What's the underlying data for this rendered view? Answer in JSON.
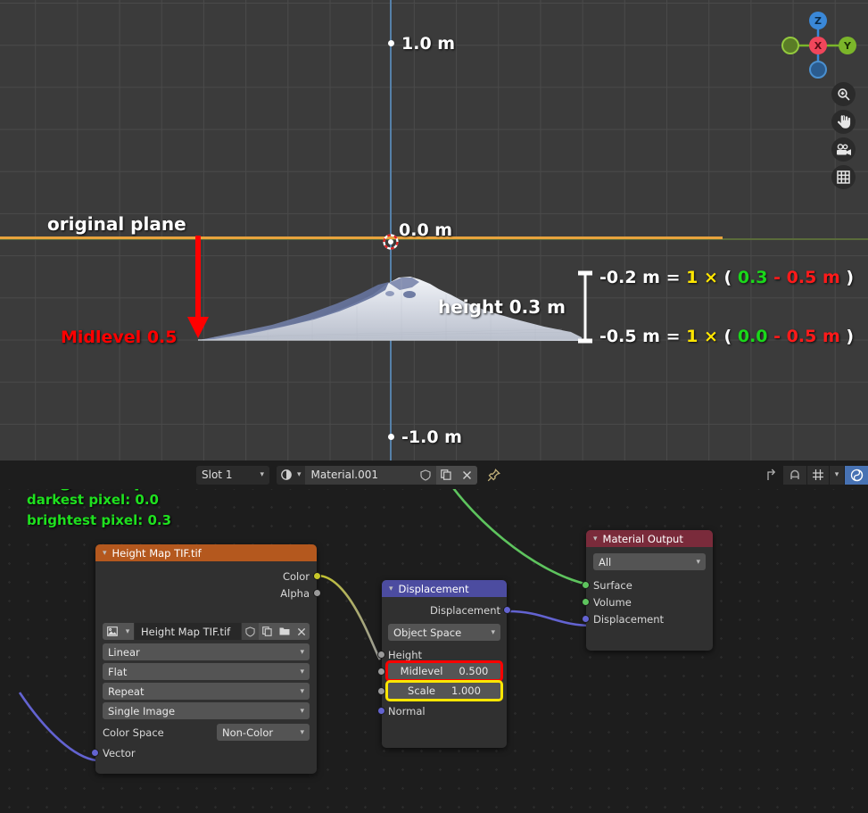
{
  "viewport": {
    "labels": {
      "top_measure": "1.0 m",
      "origin_measure": "0.0 m",
      "bottom_measure": "-1.0 m",
      "original_plane": "original plane",
      "midlevel_arrow": "Midlevel 0.5",
      "height_bracket": "height 0.3 m"
    },
    "equations": [
      {
        "result": "-0.2 m",
        "eq": "=",
        "scale": "1",
        "times": "×",
        "open": "(",
        "pixel": "0.3",
        "minus": "-",
        "midlevel": "0.5 m",
        "close": ")"
      },
      {
        "result": "-0.5 m",
        "eq": "=",
        "scale": "1",
        "times": "×",
        "open": "(",
        "pixel": "0.0",
        "minus": "-",
        "midlevel": "0.5 m",
        "close": ")"
      }
    ],
    "gizmo": {
      "z": "Z",
      "x": "X",
      "y": "Y"
    },
    "colors": {
      "background": "#3b3b3b",
      "grid": "#4a4a4a",
      "axis_z": "#5680a8",
      "axis_x": "#5a6b3a",
      "object_outline": "#e8a33d",
      "annotation_red": "#ff0000",
      "annotation_yellow": "#ffe600",
      "annotation_green": "#1ad81a",
      "annotation_white": "#ffffff"
    }
  },
  "node_editor": {
    "header": {
      "slot_label": "Slot 1",
      "material_name": "Material.001",
      "icons": [
        "material-sphere-icon",
        "shield-icon",
        "copy-icon",
        "close-icon",
        "pin-icon"
      ],
      "right_icons": [
        "snap-parent-icon",
        "magnet-icon",
        "snap-settings-icon",
        "overlay-toggle-icon"
      ]
    },
    "annotation": {
      "title": "height map",
      "line1": "darkest pixel: 0.0",
      "line2": "brightest pixel: 0.3",
      "color": "#1fe01f"
    },
    "nodes": {
      "image_texture": {
        "title": "Height Map TIF.tif",
        "header_color": "#b4581e",
        "outputs": [
          {
            "name": "Color",
            "color": "#c7c729"
          },
          {
            "name": "Alpha",
            "color": "#9a9a9a"
          }
        ],
        "image_name": "Height Map TIF.tif",
        "image_buttons": [
          "image-icon",
          "browse-chevron",
          "shield-icon",
          "copy-icon",
          "open-folder-icon",
          "close-icon"
        ],
        "interpolation": "Linear",
        "projection": "Flat",
        "extension": "Repeat",
        "source": "Single Image",
        "colorspace_label": "Color Space",
        "colorspace_value": "Non-Color",
        "input": {
          "name": "Vector",
          "color": "#6363d1"
        }
      },
      "displacement": {
        "title": "Displacement",
        "header_color": "#4c4ca0",
        "output": {
          "name": "Displacement",
          "color": "#6363d1"
        },
        "space": "Object Space",
        "inputs": [
          {
            "name": "Height",
            "color": "#9a9a9a",
            "value": null,
            "highlight": null
          },
          {
            "name": "Midlevel",
            "color": "#9a9a9a",
            "value": "0.500",
            "highlight": "#ff0000"
          },
          {
            "name": "Scale",
            "color": "#9a9a9a",
            "value": "1.000",
            "highlight": "#ffe600"
          },
          {
            "name": "Normal",
            "color": "#6363d1",
            "value": null,
            "highlight": null
          }
        ]
      },
      "material_output": {
        "title": "Material Output",
        "header_color": "#7a2b3b",
        "target": "All",
        "inputs": [
          {
            "name": "Surface",
            "color": "#5ec45e"
          },
          {
            "name": "Volume",
            "color": "#5ec45e"
          },
          {
            "name": "Displacement",
            "color": "#6363d1"
          }
        ]
      }
    }
  }
}
